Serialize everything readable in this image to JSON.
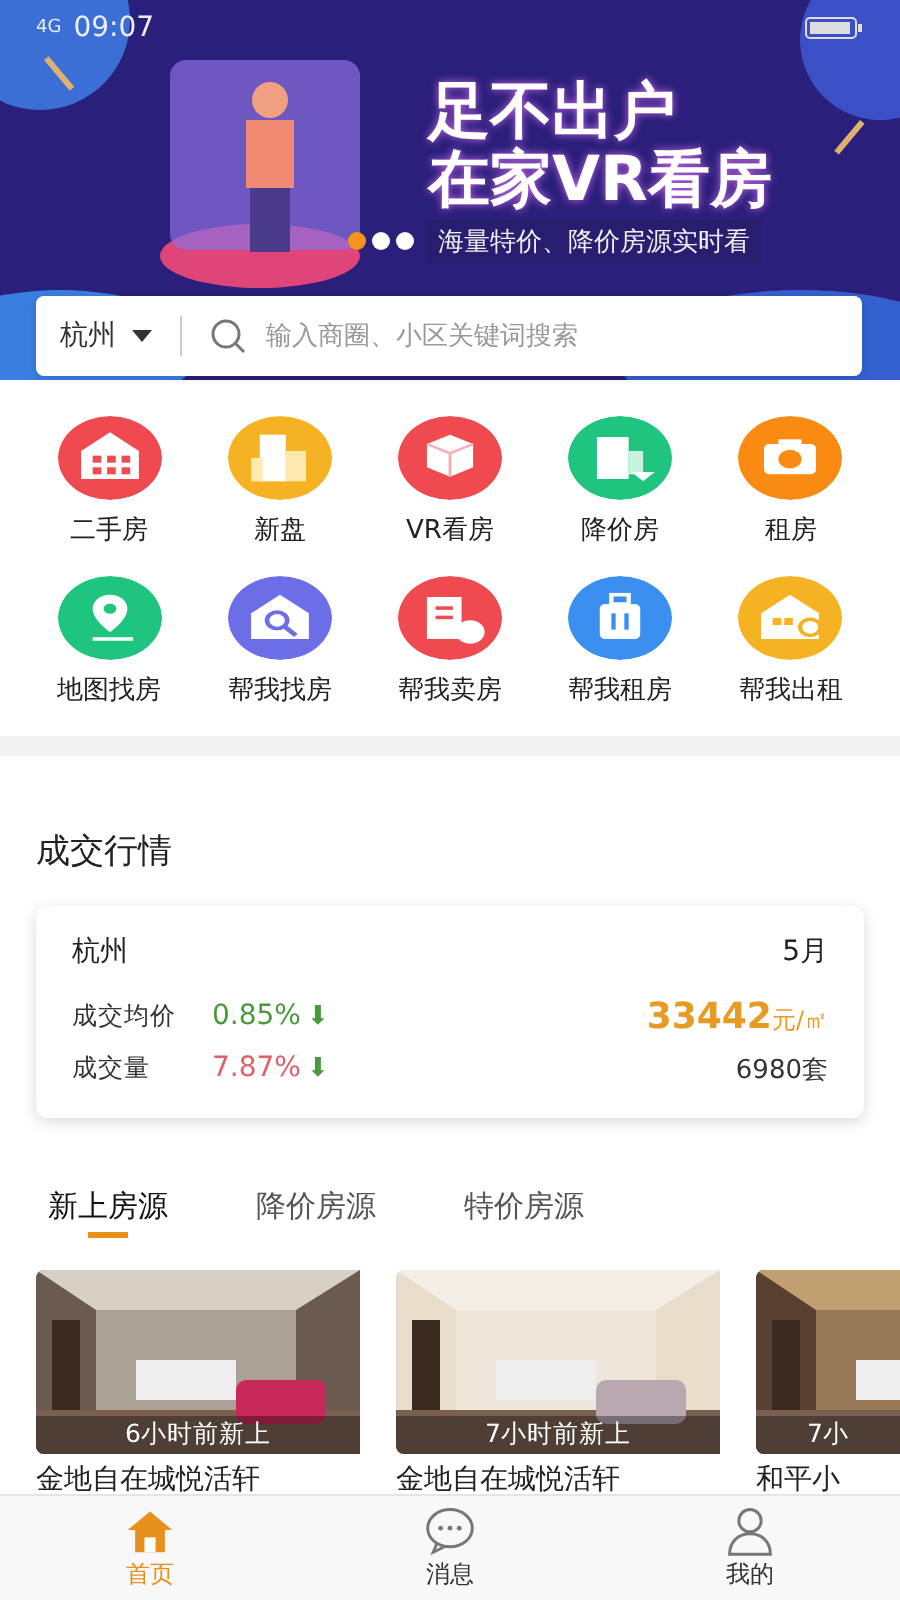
{
  "status_bar": {
    "network": "4G",
    "time": "09:07"
  },
  "banner": {
    "headline": "足不出户",
    "subheadline": "在家VR看房",
    "tagline": "海量特价、降价房源实时看",
    "dots": [
      {
        "selected": true
      },
      {
        "selected": false
      },
      {
        "selected": false
      }
    ]
  },
  "search": {
    "city": "杭州",
    "placeholder": "输入商圈、小区关键词搜索"
  },
  "shortcuts": [
    {
      "label": "二手房",
      "color": "#ef4a4f"
    },
    {
      "label": "新盘",
      "color": "#f5b324"
    },
    {
      "label": "VR看房",
      "color": "#ef4a4f"
    },
    {
      "label": "降价房",
      "color": "#1fc47f"
    },
    {
      "label": "租房",
      "color": "#f98a12"
    },
    {
      "label": "地图找房",
      "color": "#1fc47f"
    },
    {
      "label": "帮我找房",
      "color": "#6c6ee8"
    },
    {
      "label": "帮我卖房",
      "color": "#ef4a4f"
    },
    {
      "label": "帮我租房",
      "color": "#3a8ff0"
    },
    {
      "label": "帮我出租",
      "color": "#f5b324"
    }
  ],
  "market": {
    "title": "成交行情",
    "city": "杭州",
    "month": "5月",
    "rows": [
      {
        "label": "成交均价",
        "change": "0.85%",
        "arrow": "⬇",
        "color": "#4a9a3c",
        "value": "33442",
        "unit": "元/㎡",
        "highlight": true
      },
      {
        "label": "成交量",
        "change": "7.87%",
        "arrow": "⬇",
        "color": "#e0606a",
        "value": "6980套",
        "highlight": false
      }
    ]
  },
  "listing_tabs": [
    {
      "label": "新上房源",
      "selected": true
    },
    {
      "label": "降价房源",
      "selected": false
    },
    {
      "label": "特价房源",
      "selected": false
    }
  ],
  "listings": [
    {
      "badge": "6小时前新上",
      "title": "金地自在城悦活轩"
    },
    {
      "badge": "7小时前新上",
      "title": "金地自在城悦活轩"
    },
    {
      "badge": "7小",
      "title": "和平小"
    }
  ],
  "bottom_nav": [
    {
      "label": "首页",
      "selected": true
    },
    {
      "label": "消息",
      "selected": false
    },
    {
      "label": "我的",
      "selected": false
    }
  ]
}
